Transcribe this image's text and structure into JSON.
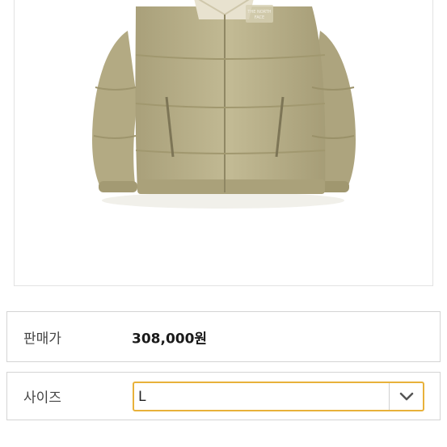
{
  "product": {
    "image_icon": "product-photo-down-jacket",
    "brand_mark": "THE NORTH FACE",
    "jacket_color": "#bdb48c"
  },
  "price": {
    "label": "판매가",
    "value": "308,000원"
  },
  "size": {
    "label": "사이즈",
    "selected": "L",
    "arrow_icon": "chevron-down-icon",
    "focus_color": "#e8b13a"
  }
}
